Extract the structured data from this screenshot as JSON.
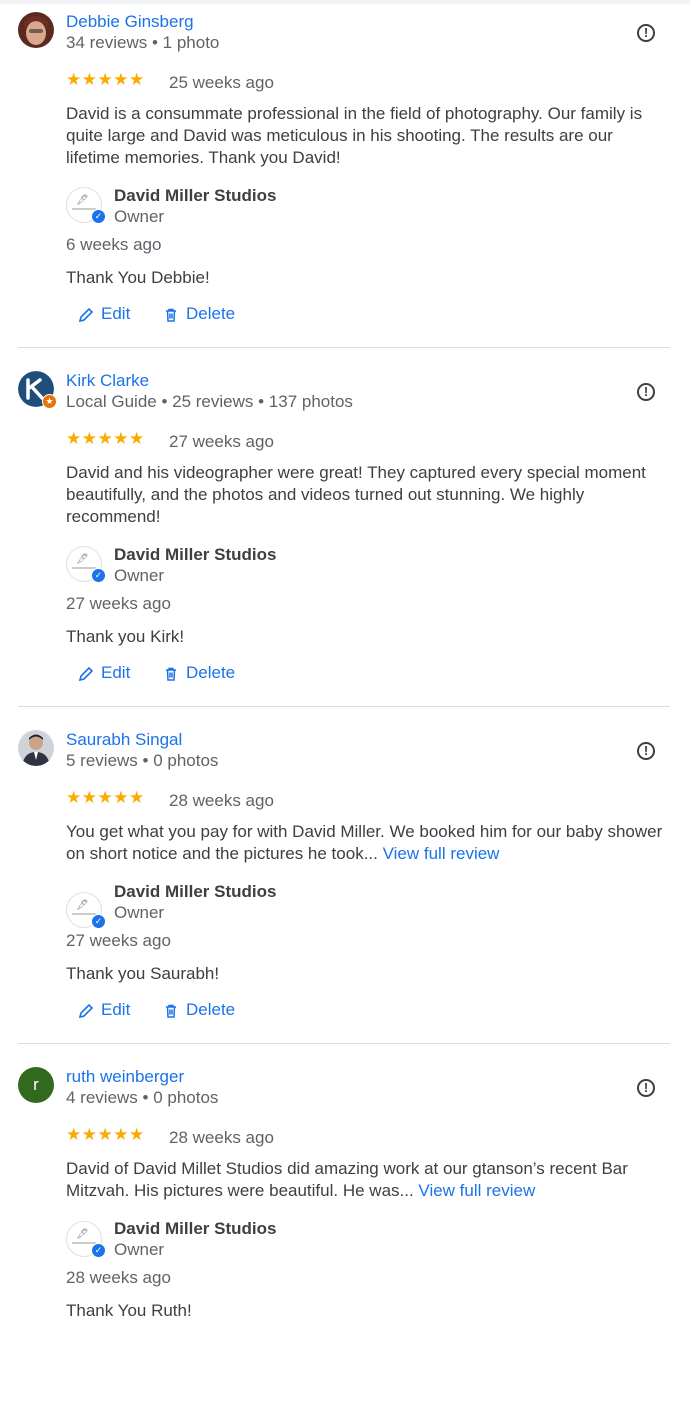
{
  "reviews": [
    {
      "author": "Debbie Ginsberg",
      "meta": "34 reviews • 1 photo",
      "avatar": {
        "kind": "photo",
        "colors": [
          "#7a3b2e",
          "#d9a78b"
        ]
      },
      "rating": 5,
      "stars": "★★★★★",
      "date": "25 weeks ago",
      "text": "David is a consummate professional in the field of photography. Our family is quite large and David was meticulous in his shooting. The results are our lifetime memories. Thank you David!",
      "more_label": "",
      "owner_name": "David Miller Studios",
      "owner_role": "Owner",
      "reply_date": "6 weeks ago",
      "reply_text": "Thank You Debbie!",
      "edit_label": "Edit",
      "delete_label": "Delete"
    },
    {
      "author": "Kirk Clarke",
      "meta": "Local Guide • 25 reviews • 137 photos",
      "avatar": {
        "kind": "logo",
        "colors": [
          "#1e4e79",
          "#ffffff"
        ]
      },
      "rating": 5,
      "stars": "★★★★★",
      "date": "27 weeks ago",
      "text": "David and his videographer were great! They captured every special moment beautifully, and the photos and videos turned out stunning. We highly recommend!",
      "more_label": "",
      "owner_name": "David Miller Studios",
      "owner_role": "Owner",
      "reply_date": "27 weeks ago",
      "reply_text": "Thank you Kirk!",
      "edit_label": "Edit",
      "delete_label": "Delete"
    },
    {
      "author": "Saurabh Singal",
      "meta": "5 reviews • 0 photos",
      "avatar": {
        "kind": "photo",
        "colors": [
          "#3b3f4a",
          "#c9a58a"
        ]
      },
      "rating": 5,
      "stars": "★★★★★",
      "date": "28 weeks ago",
      "text": "You get what you pay for with David Miller. We booked him for our baby shower on short notice and the pictures he took...",
      "more_label": "View full review",
      "owner_name": "David Miller Studios",
      "owner_role": "Owner",
      "reply_date": "27 weeks ago",
      "reply_text": "Thank you Saurabh!",
      "edit_label": "Edit",
      "delete_label": "Delete"
    },
    {
      "author": "ruth weinberger",
      "meta": "4 reviews • 0 photos",
      "avatar": {
        "kind": "letter",
        "letter": "r",
        "colors": [
          "#33691e",
          "#ffffff"
        ]
      },
      "rating": 5,
      "stars": "★★★★★",
      "date": "28 weeks ago",
      "text": "David of David Millet Studios did amazing work at our gtanson’s recent Bar Mitzvah. His pictures were beautiful. He was...",
      "more_label": "View full review",
      "owner_name": "David Miller Studios",
      "owner_role": "Owner",
      "reply_date": "28 weeks ago",
      "reply_text": "Thank You Ruth!",
      "edit_label": "Edit",
      "delete_label": "Delete"
    }
  ],
  "icons": {
    "flag": "report-icon",
    "edit": "pencil-icon",
    "delete": "trash-icon",
    "verified": "check-badge-icon"
  },
  "colors": {
    "link": "#1a73e8",
    "star": "#f9ab00",
    "text": "#3c4043",
    "muted": "#5f6368"
  }
}
